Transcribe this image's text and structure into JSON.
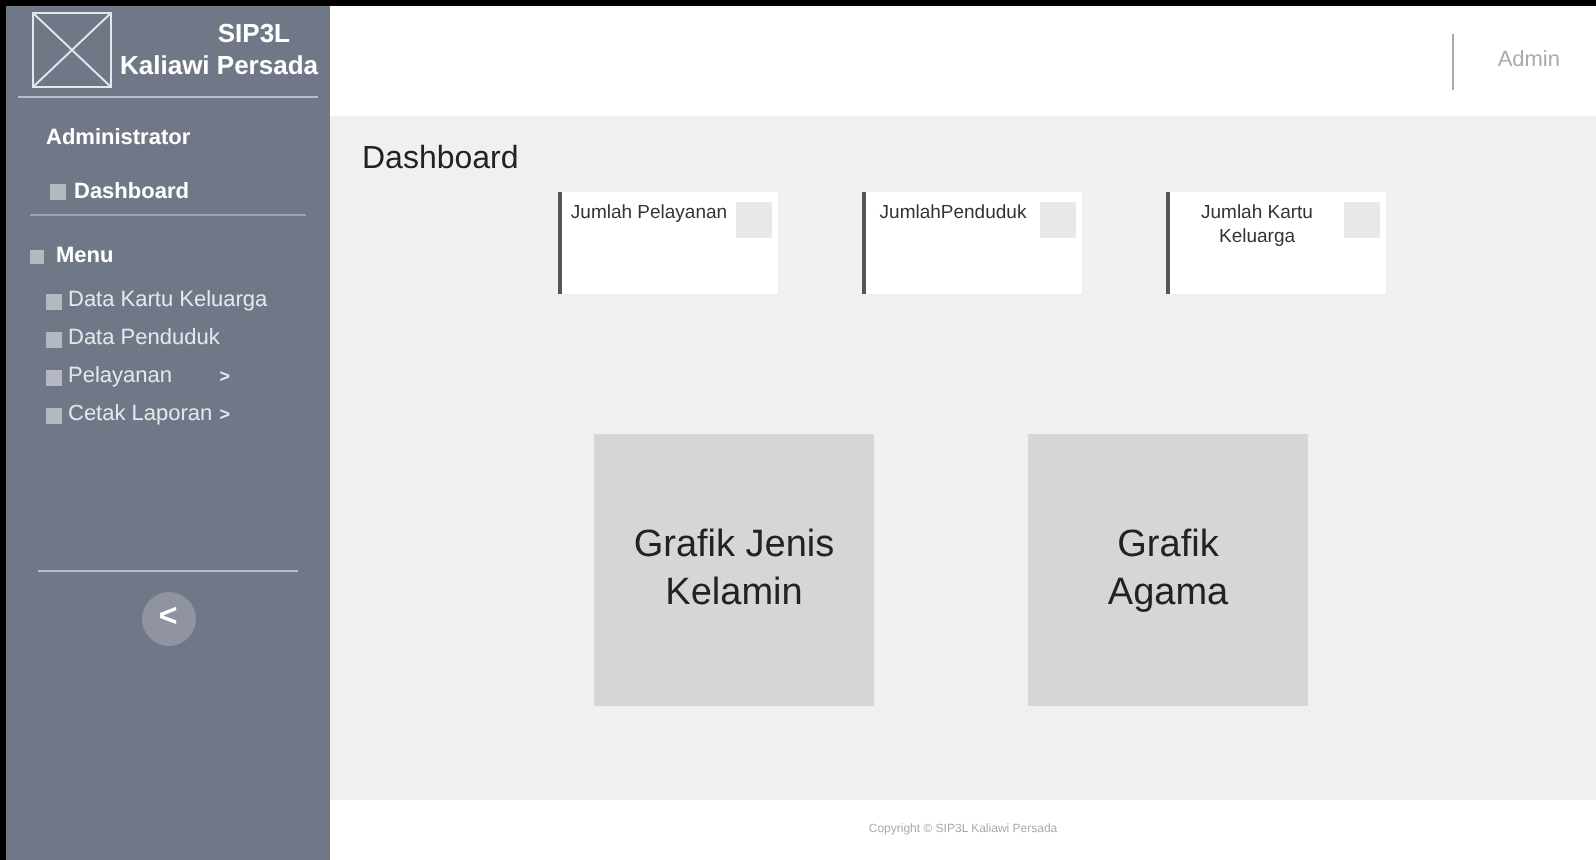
{
  "brand": {
    "line1": "SIP3L",
    "line2": "Kaliawi Persada"
  },
  "sidebar": {
    "role": "Administrator",
    "dashboard": "Dashboard",
    "menu": "Menu",
    "items": [
      {
        "label": "Data Kartu Keluarga"
      },
      {
        "label": "Data Penduduk"
      },
      {
        "label": "Pelayanan",
        "arrow": ">"
      },
      {
        "label": "Cetak Laporan",
        "arrow": ">"
      }
    ],
    "collapse": "<"
  },
  "header": {
    "user": "Admin"
  },
  "page_title": "Dashboard",
  "stat_cards": [
    {
      "label": "Jumlah Pelayanan"
    },
    {
      "label": "JumlahPenduduk"
    },
    {
      "label": "Jumlah Kartu Keluarga"
    }
  ],
  "charts": [
    {
      "label": "Grafik Jenis Kelamin"
    },
    {
      "label": "Grafik Agama"
    }
  ],
  "footer": "Copyright © SIP3L Kaliawi Persada"
}
